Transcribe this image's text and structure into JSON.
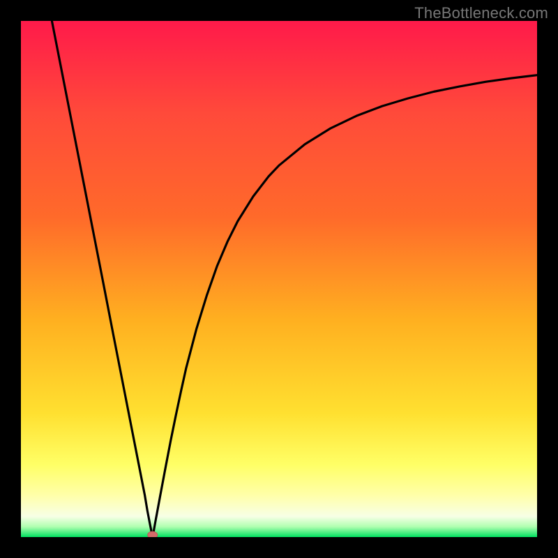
{
  "watermark": "TheBottleneck.com",
  "colors": {
    "frame_bg": "#000000",
    "gradient_top": "#ff1a4a",
    "gradient_mid1": "#ff6a2a",
    "gradient_mid2": "#ffb020",
    "gradient_mid3": "#ffe030",
    "gradient_lightyellow": "#ffff66",
    "gradient_paleyellow": "#ffffaa",
    "gradient_off": "#f7ffe6",
    "gradient_green": "#00e060",
    "curve_stroke": "#000000",
    "marker_fill": "#d46a6a",
    "marker_stroke": "#c05858"
  },
  "chart_data": {
    "type": "line",
    "title": "",
    "xlabel": "",
    "ylabel": "",
    "xlim": [
      0,
      100
    ],
    "ylim": [
      0,
      100
    ],
    "minimum_marker": {
      "x": 25.5,
      "y": 0
    },
    "curve_points": [
      {
        "x": 6.0,
        "y": 100.0
      },
      {
        "x": 8.0,
        "y": 89.8
      },
      {
        "x": 10.0,
        "y": 79.6
      },
      {
        "x": 12.0,
        "y": 69.4
      },
      {
        "x": 14.0,
        "y": 59.2
      },
      {
        "x": 16.0,
        "y": 49.0
      },
      {
        "x": 18.0,
        "y": 38.7
      },
      {
        "x": 20.0,
        "y": 28.5
      },
      {
        "x": 22.0,
        "y": 18.3
      },
      {
        "x": 23.0,
        "y": 13.2
      },
      {
        "x": 24.0,
        "y": 8.1
      },
      {
        "x": 24.5,
        "y": 5.1
      },
      {
        "x": 25.0,
        "y": 2.5
      },
      {
        "x": 25.3,
        "y": 1.0
      },
      {
        "x": 25.5,
        "y": 0.0
      },
      {
        "x": 25.7,
        "y": 1.0
      },
      {
        "x": 26.0,
        "y": 2.7
      },
      {
        "x": 26.5,
        "y": 5.4
      },
      {
        "x": 27.0,
        "y": 8.1
      },
      {
        "x": 28.0,
        "y": 13.4
      },
      {
        "x": 29.0,
        "y": 18.6
      },
      {
        "x": 30.0,
        "y": 23.5
      },
      {
        "x": 31.0,
        "y": 28.2
      },
      {
        "x": 32.0,
        "y": 32.7
      },
      {
        "x": 34.0,
        "y": 40.3
      },
      {
        "x": 36.0,
        "y": 46.8
      },
      {
        "x": 38.0,
        "y": 52.5
      },
      {
        "x": 40.0,
        "y": 57.2
      },
      {
        "x": 42.0,
        "y": 61.2
      },
      {
        "x": 45.0,
        "y": 66.0
      },
      {
        "x": 48.0,
        "y": 69.9
      },
      {
        "x": 50.0,
        "y": 72.0
      },
      {
        "x": 55.0,
        "y": 76.1
      },
      {
        "x": 60.0,
        "y": 79.2
      },
      {
        "x": 65.0,
        "y": 81.6
      },
      {
        "x": 70.0,
        "y": 83.5
      },
      {
        "x": 75.0,
        "y": 85.0
      },
      {
        "x": 80.0,
        "y": 86.3
      },
      {
        "x": 85.0,
        "y": 87.3
      },
      {
        "x": 90.0,
        "y": 88.2
      },
      {
        "x": 95.0,
        "y": 88.9
      },
      {
        "x": 100.0,
        "y": 89.5
      }
    ]
  }
}
